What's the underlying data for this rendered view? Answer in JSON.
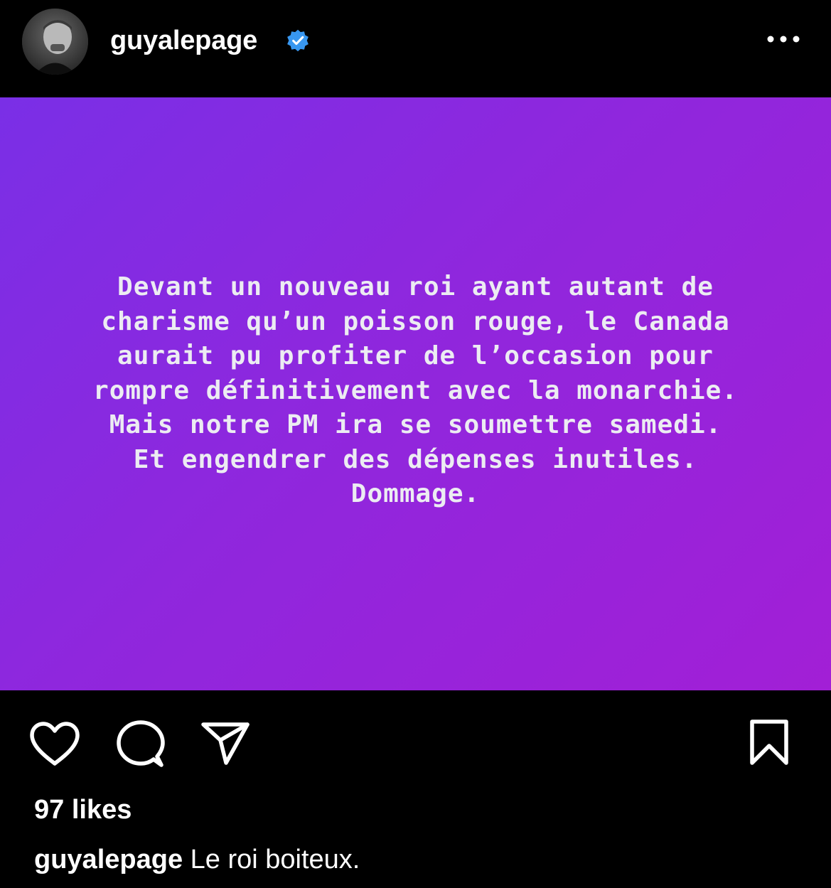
{
  "header": {
    "username": "guyalepage",
    "verified": true,
    "more_icon": "more-horizontal-icon"
  },
  "post": {
    "background_colors": [
      "#7a2fe6",
      "#a21fd6"
    ],
    "text_lines": [
      "Devant un nouveau roi ayant autant de",
      "charisme qu’un poisson rouge, le Canada",
      "aurait pu profiter de l’occasion pour",
      "rompre définitivement avec la monarchie.",
      "Mais notre PM ira se soumettre samedi.",
      "Et engendrer des dépenses inutiles.",
      "Dommage."
    ]
  },
  "actions": {
    "like_icon": "heart-icon",
    "comment_icon": "comment-icon",
    "share_icon": "paper-plane-icon",
    "save_icon": "bookmark-icon"
  },
  "likes_text": "97 likes",
  "caption": {
    "username": "guyalepage",
    "text": "Le roi boiteux."
  },
  "colors": {
    "verified_badge": "#3897f0",
    "background": "#000000"
  }
}
